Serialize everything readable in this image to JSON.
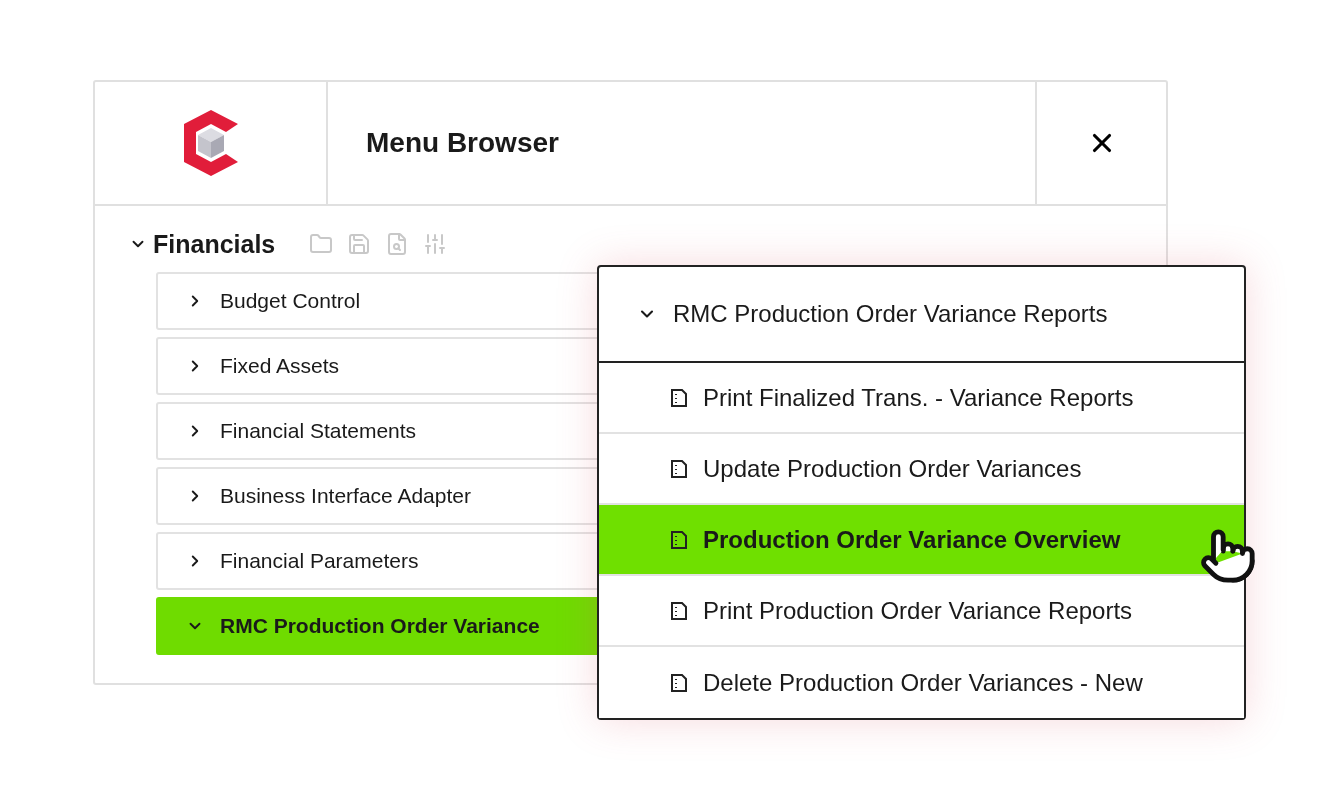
{
  "header": {
    "title": "Menu Browser"
  },
  "tree": {
    "label": "Financials",
    "expanded": true,
    "children": [
      {
        "label": "Budget Control",
        "expanded": false,
        "selected": false
      },
      {
        "label": "Fixed Assets",
        "expanded": false,
        "selected": false
      },
      {
        "label": "Financial Statements",
        "expanded": false,
        "selected": false
      },
      {
        "label": "Business Interface Adapter",
        "expanded": false,
        "selected": false
      },
      {
        "label": "Financial Parameters",
        "expanded": false,
        "selected": false
      },
      {
        "label": "RMC Production Order Variance",
        "expanded": true,
        "selected": true
      }
    ]
  },
  "popup": {
    "title": "RMC Production Order Variance Reports",
    "expanded": true,
    "items": [
      {
        "label": "Print Finalized Trans. - Variance Reports",
        "selected": false
      },
      {
        "label": "Update Production Order Variances",
        "selected": false
      },
      {
        "label": "Production Order Variance Overview",
        "selected": true
      },
      {
        "label": "Print Production Order Variance Reports",
        "selected": false
      },
      {
        "label": "Delete Production Order Variances - New",
        "selected": false
      }
    ]
  }
}
